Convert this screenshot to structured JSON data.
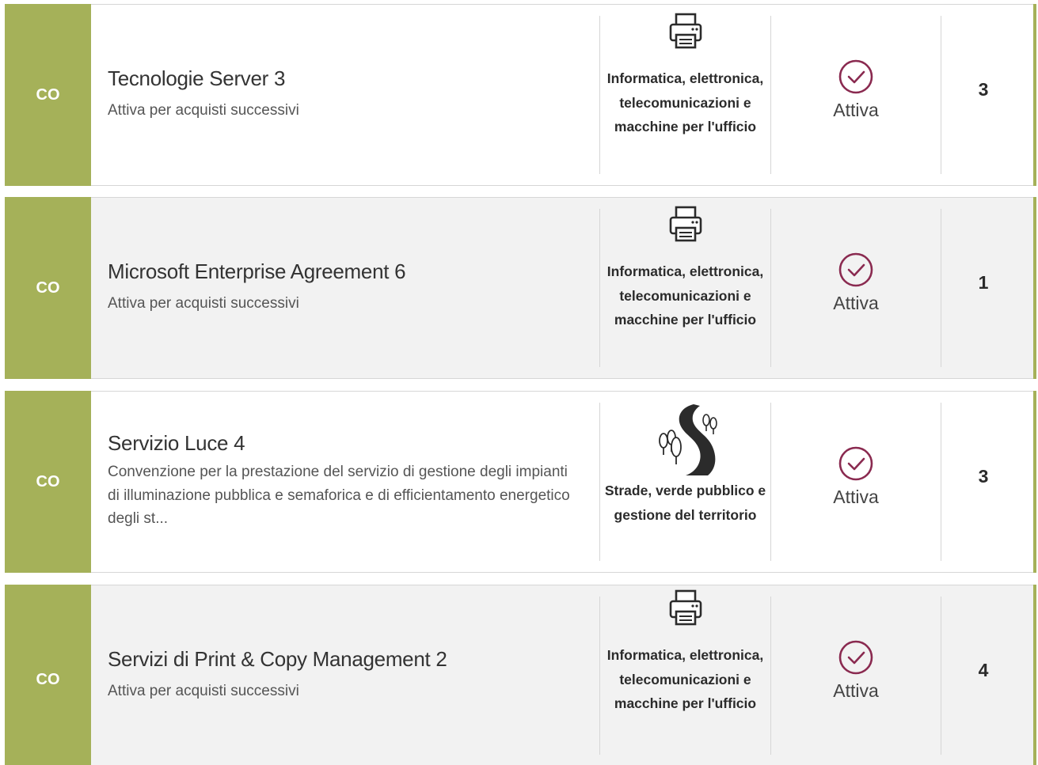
{
  "accent_color": "#a5b159",
  "status_color": "#8a2a50",
  "items": [
    {
      "type": "CO",
      "title": "Tecnologie Server 3",
      "description": "Attiva per acquisti successivi",
      "category_icon": "printer-icon",
      "category": "Informatica, elettronica, telecomunicazioni e macchine per l'ufficio",
      "status_icon": "check-circle-icon",
      "status": "Attiva",
      "count": "3"
    },
    {
      "type": "CO",
      "title": "Microsoft Enterprise Agreement 6",
      "description": "Attiva per acquisti successivi",
      "category_icon": "printer-icon",
      "category": "Informatica, elettronica, telecomunicazioni e macchine per l'ufficio",
      "status_icon": "check-circle-icon",
      "status": "Attiva",
      "count": "1"
    },
    {
      "type": "CO",
      "title": "Servizio Luce 4",
      "description": "Convenzione per la prestazione del servizio di gestione degli impianti di illuminazione pubblica e semaforica e di efficientamento energetico degli st...",
      "category_icon": "road-trees-icon",
      "category": "Strade, verde pubblico e gestione del territorio",
      "status_icon": "check-circle-icon",
      "status": "Attiva",
      "count": "3"
    },
    {
      "type": "CO",
      "title": "Servizi di Print & Copy Management 2",
      "description": "Attiva per acquisti successivi",
      "category_icon": "printer-icon",
      "category": "Informatica, elettronica, telecomunicazioni e macchine per l'ufficio",
      "status_icon": "check-circle-icon",
      "status": "Attiva",
      "count": "4"
    }
  ]
}
